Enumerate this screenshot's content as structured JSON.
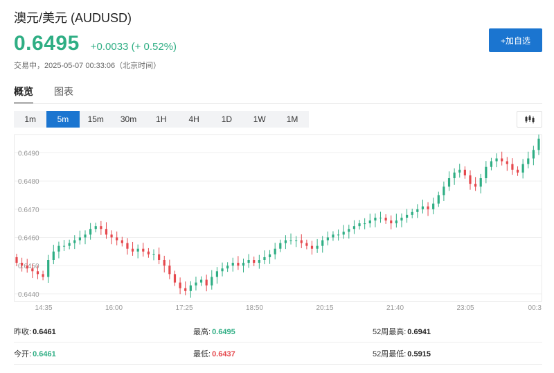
{
  "header": {
    "title": "澳元/美元  (AUDUSD)",
    "price": "0.6495",
    "change": "+0.0033 (+ 0.52%)",
    "status": "交易中，2025-05-07 00:33:06（北京时间）",
    "add_button": "+加自选"
  },
  "tabs": [
    {
      "label": "概览"
    },
    {
      "label": "图表"
    }
  ],
  "periods": [
    {
      "label": "1m"
    },
    {
      "label": "5m"
    },
    {
      "label": "15m"
    },
    {
      "label": "30m"
    },
    {
      "label": "1H"
    },
    {
      "label": "4H"
    },
    {
      "label": "1D"
    },
    {
      "label": "1W"
    },
    {
      "label": "1M"
    }
  ],
  "active_period": "5m",
  "chart_type_icon": "candlestick-icon",
  "colors": {
    "up": "#2fae84",
    "down": "#e5484d",
    "accent": "#1b75d0"
  },
  "chart_data": {
    "type": "candlestick",
    "ylim": [
      0.644,
      0.6495
    ],
    "y_ticks": [
      "0.6440",
      "0.6450",
      "0.6460",
      "0.6470",
      "0.6480",
      "0.6490"
    ],
    "x_ticks": [
      "14:35",
      "16:00",
      "17:25",
      "18:50",
      "20:15",
      "21:40",
      "23:05",
      "00:3"
    ],
    "grid": true,
    "close": [
      0.6451,
      0.645,
      0.6449,
      0.6448,
      0.6447,
      0.6446,
      0.6452,
      0.6455,
      0.6457,
      0.6457,
      0.6458,
      0.6459,
      0.646,
      0.6461,
      0.6463,
      0.6464,
      0.6463,
      0.6461,
      0.646,
      0.6459,
      0.6458,
      0.6456,
      0.6455,
      0.6456,
      0.6455,
      0.6454,
      0.6454,
      0.6452,
      0.645,
      0.6447,
      0.6444,
      0.6442,
      0.6441,
      0.6443,
      0.6444,
      0.6445,
      0.6443,
      0.6446,
      0.6448,
      0.6449,
      0.645,
      0.6451,
      0.645,
      0.6451,
      0.6452,
      0.6451,
      0.6452,
      0.6453,
      0.6454,
      0.6456,
      0.6458,
      0.6459,
      0.6459,
      0.6459,
      0.6458,
      0.6457,
      0.6456,
      0.6457,
      0.6459,
      0.646,
      0.6461,
      0.6461,
      0.6462,
      0.6463,
      0.6464,
      0.6465,
      0.6465,
      0.6466,
      0.6467,
      0.6467,
      0.6466,
      0.6465,
      0.6466,
      0.6467,
      0.6468,
      0.6469,
      0.647,
      0.6471,
      0.647,
      0.6472,
      0.6475,
      0.6478,
      0.6481,
      0.6483,
      0.6484,
      0.6482,
      0.6479,
      0.6478,
      0.6481,
      0.6485,
      0.6487,
      0.6488,
      0.6487,
      0.6486,
      0.6484,
      0.6483,
      0.6486,
      0.6488,
      0.6491,
      0.6495
    ]
  },
  "stats": {
    "prev_close_label": "昨收:",
    "prev_close": "0.6461",
    "high_label": "最高:",
    "high": "0.6495",
    "high52_label": "52周最高:",
    "high52": "0.6941",
    "open_label": "今开:",
    "open": "0.6461",
    "low_label": "最低:",
    "low": "0.6437",
    "low52_label": "52周最低:",
    "low52": "0.5915"
  }
}
